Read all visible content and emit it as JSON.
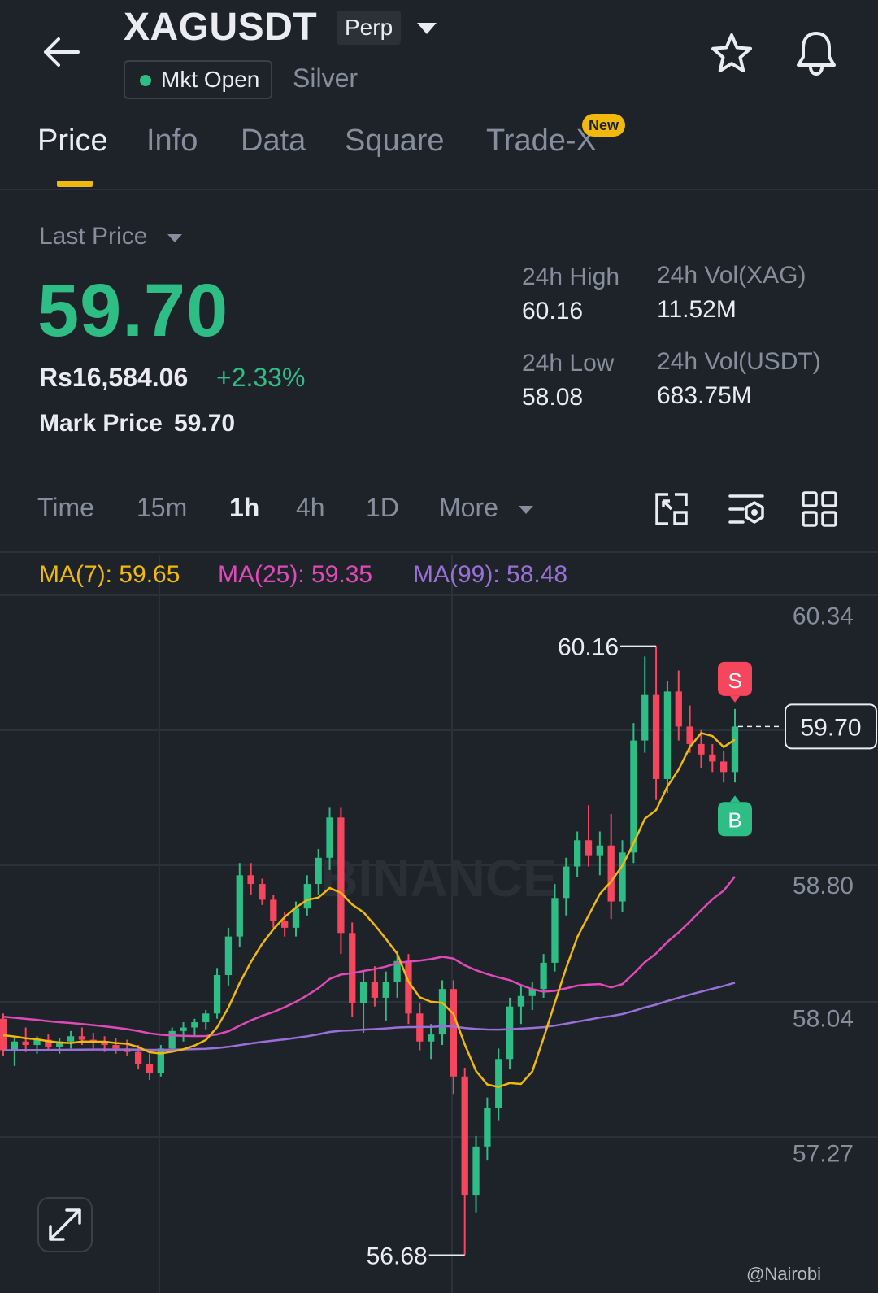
{
  "header": {
    "symbol": "XAGUSDT",
    "contract_type": "Perp",
    "market_status": "Mkt Open",
    "asset_name": "Silver"
  },
  "tabs": [
    {
      "label": "Price",
      "active": true
    },
    {
      "label": "Info",
      "active": false
    },
    {
      "label": "Data",
      "active": false
    },
    {
      "label": "Square",
      "active": false
    },
    {
      "label": "Trade-X",
      "active": false,
      "badge": "New"
    }
  ],
  "price": {
    "selector_label": "Last Price",
    "last_price": "59.70",
    "fiat_price": "Rs16,584.06",
    "change_pct": "+2.33%",
    "mark_label": "Mark Price",
    "mark_price": "59.70"
  },
  "stats": {
    "high_label": "24h High",
    "high_value": "60.16",
    "low_label": "24h Low",
    "low_value": "58.08",
    "vol_base_label": "24h Vol(XAG)",
    "vol_base_value": "11.52M",
    "vol_quote_label": "24h Vol(USDT)",
    "vol_quote_value": "683.75M"
  },
  "intervals": {
    "items": [
      {
        "label": "Time",
        "active": false
      },
      {
        "label": "15m",
        "active": false
      },
      {
        "label": "1h",
        "active": true
      },
      {
        "label": "4h",
        "active": false
      },
      {
        "label": "1D",
        "active": false
      }
    ],
    "more_label": "More"
  },
  "indicators": {
    "ma7": "MA(7): 59.65",
    "ma25": "MA(25): 59.35",
    "ma99": "MA(99): 58.48"
  },
  "colors": {
    "up": "#2ebd85",
    "down": "#f6465d",
    "accent": "#f0b90b",
    "ma7": "#f0b90b",
    "ma25": "#e04ab8",
    "ma99": "#9b6fd8",
    "bg": "#1e2229"
  },
  "chart_data": {
    "type": "candlestick",
    "interval": "1h",
    "y_ticks": [
      "60.34",
      "58.80",
      "58.04",
      "57.27"
    ],
    "ylim": [
      56.5,
      60.45
    ],
    "period_high_label": "60.16",
    "period_low_label": "56.68",
    "current_price_label": "59.70",
    "current_price": 59.7,
    "markers": [
      {
        "label": "S",
        "side": "sell"
      },
      {
        "label": "B",
        "side": "buy"
      }
    ],
    "watermark": "BINANCE",
    "credit": "@Nairobi",
    "candles": [
      [
        58.03,
        58.06,
        57.82,
        57.85
      ],
      [
        57.85,
        57.92,
        57.76,
        57.9
      ],
      [
        57.9,
        57.98,
        57.84,
        57.88
      ],
      [
        57.88,
        57.93,
        57.83,
        57.91
      ],
      [
        57.91,
        57.94,
        57.85,
        57.87
      ],
      [
        57.87,
        57.92,
        57.83,
        57.9
      ],
      [
        57.9,
        57.96,
        57.86,
        57.93
      ],
      [
        57.93,
        57.98,
        57.88,
        57.91
      ],
      [
        57.91,
        57.95,
        57.86,
        57.89
      ],
      [
        57.89,
        57.93,
        57.84,
        57.88
      ],
      [
        57.88,
        57.92,
        57.83,
        57.86
      ],
      [
        57.86,
        57.91,
        57.82,
        57.84
      ],
      [
        57.84,
        57.88,
        57.74,
        57.77
      ],
      [
        57.77,
        57.83,
        57.68,
        57.72
      ],
      [
        57.72,
        57.88,
        57.7,
        57.86
      ],
      [
        57.86,
        57.98,
        57.84,
        57.96
      ],
      [
        57.96,
        58.01,
        57.9,
        57.98
      ],
      [
        57.98,
        58.03,
        57.93,
        58.01
      ],
      [
        58.01,
        58.08,
        57.97,
        58.06
      ],
      [
        58.06,
        58.32,
        58.03,
        58.28
      ],
      [
        58.28,
        58.55,
        58.22,
        58.5
      ],
      [
        58.5,
        58.92,
        58.44,
        58.85
      ],
      [
        58.85,
        58.92,
        58.74,
        58.8
      ],
      [
        58.8,
        58.83,
        58.68,
        58.71
      ],
      [
        58.71,
        58.74,
        58.55,
        58.59
      ],
      [
        58.59,
        58.64,
        58.5,
        58.55
      ],
      [
        58.55,
        58.7,
        58.5,
        58.66
      ],
      [
        58.66,
        58.85,
        58.62,
        58.8
      ],
      [
        58.8,
        59.0,
        58.74,
        58.95
      ],
      [
        58.95,
        59.24,
        58.88,
        59.18
      ],
      [
        59.18,
        59.24,
        58.4,
        58.52
      ],
      [
        58.52,
        58.58,
        58.04,
        58.12
      ],
      [
        58.12,
        58.3,
        57.95,
        58.24
      ],
      [
        58.24,
        58.33,
        58.1,
        58.15
      ],
      [
        58.15,
        58.3,
        58.02,
        58.24
      ],
      [
        58.24,
        58.42,
        58.15,
        58.36
      ],
      [
        58.36,
        58.4,
        58.0,
        58.06
      ],
      [
        58.06,
        58.12,
        57.85,
        57.9
      ],
      [
        57.9,
        58.0,
        57.8,
        57.94
      ],
      [
        57.94,
        58.25,
        57.88,
        58.2
      ],
      [
        58.2,
        58.25,
        57.6,
        57.7
      ],
      [
        57.7,
        57.75,
        56.68,
        57.02
      ],
      [
        57.02,
        57.36,
        56.92,
        57.3
      ],
      [
        57.3,
        57.58,
        57.22,
        57.52
      ],
      [
        57.52,
        57.86,
        57.45,
        57.8
      ],
      [
        57.8,
        58.15,
        57.74,
        58.1
      ],
      [
        58.1,
        58.22,
        58.0,
        58.16
      ],
      [
        58.16,
        58.24,
        58.08,
        58.2
      ],
      [
        58.2,
        58.4,
        58.15,
        58.35
      ],
      [
        58.35,
        58.8,
        58.3,
        58.72
      ],
      [
        58.72,
        58.95,
        58.62,
        58.9
      ],
      [
        58.9,
        59.1,
        58.84,
        59.05
      ],
      [
        59.05,
        59.25,
        58.9,
        58.96
      ],
      [
        58.96,
        59.1,
        58.85,
        59.02
      ],
      [
        59.02,
        59.2,
        58.6,
        58.7
      ],
      [
        58.7,
        59.05,
        58.64,
        58.98
      ],
      [
        58.98,
        59.72,
        58.92,
        59.62
      ],
      [
        59.62,
        60.1,
        59.55,
        59.88
      ],
      [
        59.88,
        60.16,
        59.28,
        59.4
      ],
      [
        59.4,
        59.96,
        59.32,
        59.9
      ],
      [
        59.9,
        60.02,
        59.62,
        59.7
      ],
      [
        59.7,
        59.82,
        59.55,
        59.6
      ],
      [
        59.6,
        59.68,
        59.46,
        59.54
      ],
      [
        59.54,
        59.6,
        59.44,
        59.5
      ],
      [
        59.5,
        59.56,
        59.38,
        59.44
      ],
      [
        59.44,
        59.8,
        59.38,
        59.7
      ]
    ]
  }
}
